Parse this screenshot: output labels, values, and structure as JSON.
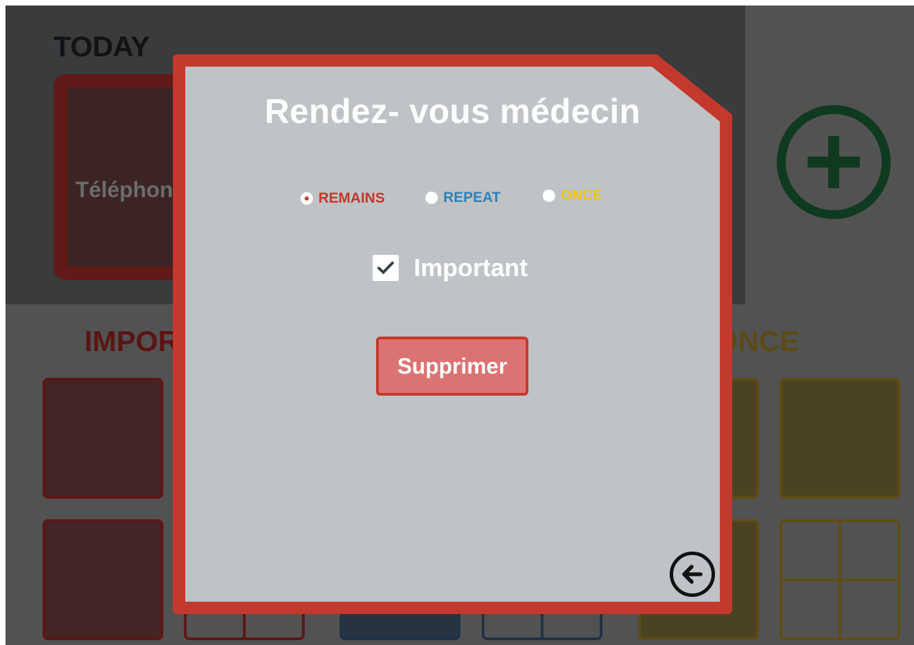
{
  "background": {
    "today_title": "TODAY",
    "today_card_label": "Téléphon",
    "section_important": "IMPOR",
    "section_once": "ONCE",
    "add_icon": "plus-circle-icon"
  },
  "modal": {
    "title": "Rendez- vous médecin",
    "options": [
      {
        "label": "REMAINS",
        "color": "#c0392b",
        "selected": true
      },
      {
        "label": "REPEAT",
        "color": "#2f80b8",
        "selected": false
      },
      {
        "label": "ONCE",
        "color": "#f1c40f",
        "selected": false
      }
    ],
    "important": {
      "label": "Important",
      "checked": true
    },
    "delete_label": "Supprimer",
    "back_icon": "arrow-left-circle-icon"
  },
  "colors": {
    "accent_red": "#c4392d",
    "modal_bg": "#bfc3c6",
    "delete_bg": "#dc7373"
  }
}
